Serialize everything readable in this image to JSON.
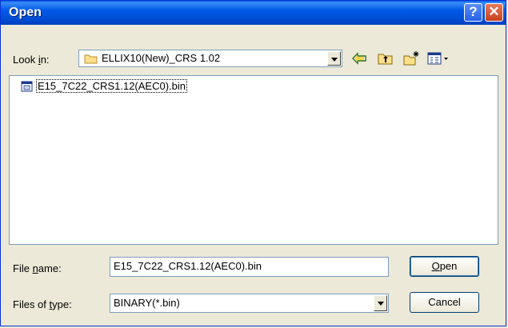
{
  "window": {
    "title": "Open",
    "help_glyph": "?",
    "close_glyph": "✕"
  },
  "lookin": {
    "label_pre": "Look ",
    "label_hot": "i",
    "label_post": "n:",
    "folder": "ELLIX10(New)_CRS 1.02",
    "icons": [
      "folder-icon",
      "back-arrow-icon",
      "up-folder-icon",
      "new-folder-icon",
      "view-menu-icon"
    ]
  },
  "files": [
    {
      "name": "E15_7C22_CRS1.12(AEC0).bin",
      "icon": "binary-file-icon"
    }
  ],
  "filename": {
    "label_pre": "File ",
    "label_hot": "n",
    "label_post": "ame:",
    "value": "E15_7C22_CRS1.12(AEC0).bin"
  },
  "filetype": {
    "label_pre": "Files of ",
    "label_hot": "t",
    "label_post": "ype:",
    "value": "BINARY(*.bin)"
  },
  "buttons": {
    "open_hot": "O",
    "open_rest": "pen",
    "cancel": "Cancel"
  },
  "colors": {
    "titlebar": "#0054e3",
    "face": "#ece9d8",
    "border": "#7f9db9"
  }
}
